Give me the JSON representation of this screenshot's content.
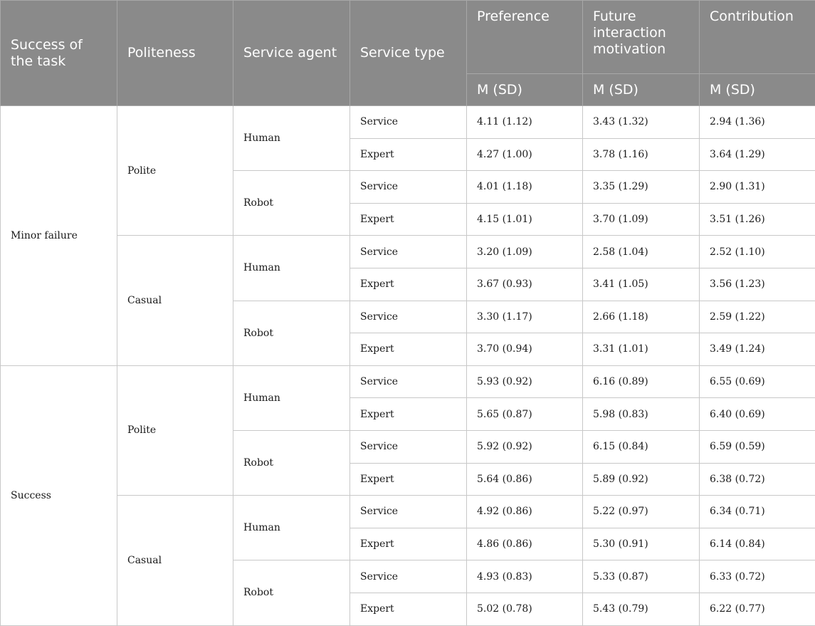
{
  "table": {
    "headers": {
      "success": "Success of the task",
      "politeness": "Politeness",
      "agent": "Service agent",
      "type": "Service type",
      "preference": "Preference",
      "future": "Future interaction motivation",
      "contribution": "Contribution",
      "msd": "M (SD)"
    },
    "outcomes": [
      {
        "label": "Minor failure",
        "politeness": [
          {
            "label": "Polite",
            "agents": [
              {
                "label": "Human",
                "rows": [
                  {
                    "type": "Service",
                    "pref": "4.11 (1.12)",
                    "fut": "3.43 (1.32)",
                    "contrib": "2.94 (1.36)"
                  },
                  {
                    "type": "Expert",
                    "pref": "4.27 (1.00)",
                    "fut": "3.78 (1.16)",
                    "contrib": "3.64 (1.29)"
                  }
                ]
              },
              {
                "label": "Robot",
                "rows": [
                  {
                    "type": "Service",
                    "pref": "4.01 (1.18)",
                    "fut": "3.35 (1.29)",
                    "contrib": "2.90 (1.31)"
                  },
                  {
                    "type": "Expert",
                    "pref": "4.15 (1.01)",
                    "fut": "3.70 (1.09)",
                    "contrib": "3.51 (1.26)"
                  }
                ]
              }
            ]
          },
          {
            "label": "Casual",
            "agents": [
              {
                "label": "Human",
                "rows": [
                  {
                    "type": "Service",
                    "pref": "3.20 (1.09)",
                    "fut": "2.58 (1.04)",
                    "contrib": "2.52 (1.10)"
                  },
                  {
                    "type": "Expert",
                    "pref": "3.67 (0.93)",
                    "fut": "3.41 (1.05)",
                    "contrib": "3.56 (1.23)"
                  }
                ]
              },
              {
                "label": "Robot",
                "rows": [
                  {
                    "type": "Service",
                    "pref": "3.30 (1.17)",
                    "fut": "2.66 (1.18)",
                    "contrib": "2.59 (1.22)"
                  },
                  {
                    "type": "Expert",
                    "pref": "3.70 (0.94)",
                    "fut": "3.31 (1.01)",
                    "contrib": "3.49 (1.24)"
                  }
                ]
              }
            ]
          }
        ]
      },
      {
        "label": "Success",
        "politeness": [
          {
            "label": "Polite",
            "agents": [
              {
                "label": "Human",
                "rows": [
                  {
                    "type": "Service",
                    "pref": "5.93 (0.92)",
                    "fut": "6.16 (0.89)",
                    "contrib": "6.55 (0.69)"
                  },
                  {
                    "type": "Expert",
                    "pref": "5.65 (0.87)",
                    "fut": "5.98 (0.83)",
                    "contrib": "6.40 (0.69)"
                  }
                ]
              },
              {
                "label": "Robot",
                "rows": [
                  {
                    "type": "Service",
                    "pref": "5.92 (0.92)",
                    "fut": "6.15 (0.84)",
                    "contrib": "6.59 (0.59)"
                  },
                  {
                    "type": "Expert",
                    "pref": "5.64 (0.86)",
                    "fut": "5.89 (0.92)",
                    "contrib": "6.38 (0.72)"
                  }
                ]
              }
            ]
          },
          {
            "label": "Casual",
            "agents": [
              {
                "label": "Human",
                "rows": [
                  {
                    "type": "Service",
                    "pref": "4.92 (0.86)",
                    "fut": "5.22 (0.97)",
                    "contrib": "6.34 (0.71)"
                  },
                  {
                    "type": "Expert",
                    "pref": "4.86 (0.86)",
                    "fut": "5.30 (0.91)",
                    "contrib": "6.14 (0.84)"
                  }
                ]
              },
              {
                "label": "Robot",
                "rows": [
                  {
                    "type": "Service",
                    "pref": "4.93 (0.83)",
                    "fut": "5.33 (0.87)",
                    "contrib": "6.33 (0.72)"
                  },
                  {
                    "type": "Expert",
                    "pref": "5.02 (0.78)",
                    "fut": "5.43 (0.79)",
                    "contrib": "6.22 (0.77)"
                  }
                ]
              }
            ]
          }
        ]
      }
    ]
  }
}
